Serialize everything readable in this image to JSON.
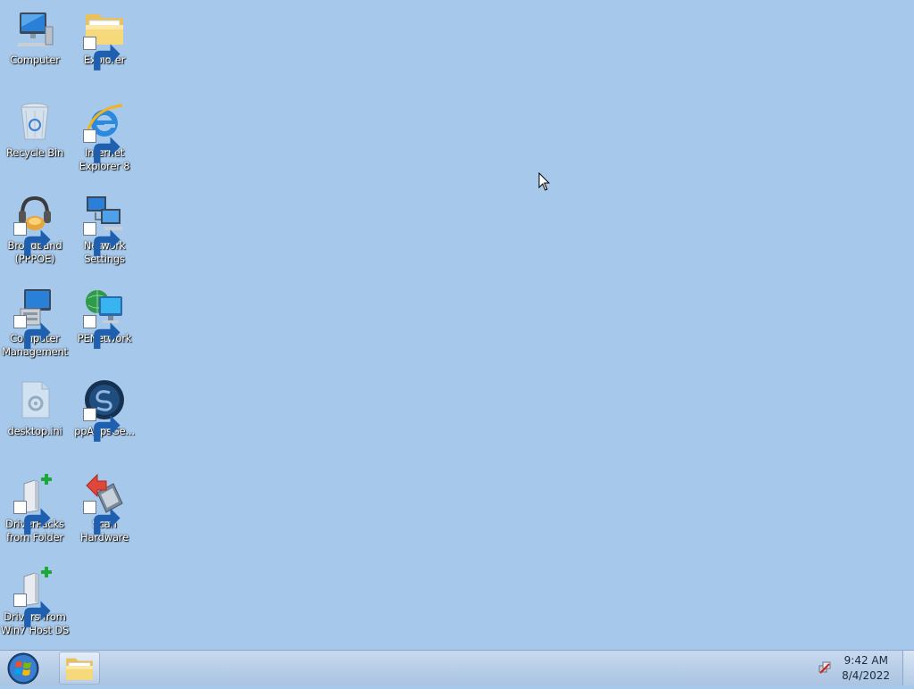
{
  "desktop": {
    "icons": [
      {
        "label": "Computer",
        "icon": "computer-icon"
      },
      {
        "label": "Explorer",
        "icon": "folder-icon"
      },
      {
        "label": "Recycle Bin",
        "icon": "recycle-bin-icon"
      },
      {
        "label": "Internet\nExplorer 8",
        "icon": "internet-explorer-icon"
      },
      {
        "label": "Broadband\n(PPPOE)",
        "icon": "broadband-icon"
      },
      {
        "label": "Network\nSettings",
        "icon": "network-settings-icon"
      },
      {
        "label": "Computer\nManagement",
        "icon": "computer-management-icon"
      },
      {
        "label": "PENetwork",
        "icon": "penetwork-icon"
      },
      {
        "label": "desktop.ini",
        "icon": "ini-file-icon"
      },
      {
        "label": "ppAppsGe...",
        "icon": "ppapps-icon"
      },
      {
        "label": "DriverPacks\nfrom Folder",
        "icon": "driverpacks-icon"
      },
      {
        "label": "Scan\nHardware",
        "icon": "scan-hardware-icon"
      },
      {
        "label": "Drivers from\nWin7 Host DS",
        "icon": "drivers-host-icon"
      }
    ]
  },
  "taskbar": {
    "start_icon": "windows-start-icon",
    "pinned_icon": "folder-icon",
    "tray_icon": "network-tray-icon",
    "time": "9:42 AM",
    "date": "8/4/2022"
  },
  "colors": {
    "desktop_bg": "#a6c8ea",
    "taskbar_top": "#c7d9ee",
    "taskbar_bottom": "#aac4e2"
  }
}
